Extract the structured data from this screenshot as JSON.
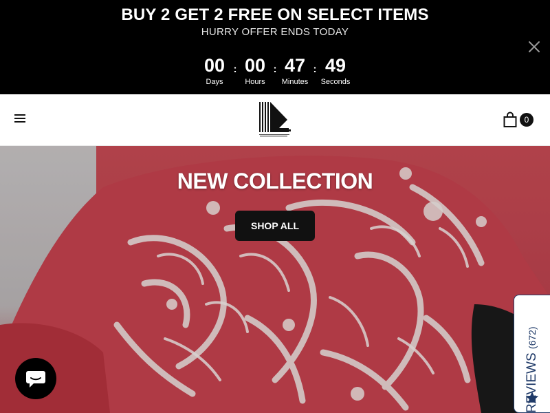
{
  "promo": {
    "title": "BUY 2 GET 2 FREE ON SELECT ITEMS",
    "subtitle": "HURRY OFFER ENDS TODAY",
    "close_icon": "close-icon",
    "countdown": [
      {
        "value": "00",
        "label": "Days"
      },
      {
        "value": "00",
        "label": "Hours"
      },
      {
        "value": "47",
        "label": "Minutes"
      },
      {
        "value": "49",
        "label": "Seconds"
      }
    ],
    "separator": ":"
  },
  "header": {
    "menu_icon": "hamburger-menu-icon",
    "logo_icon": "brand-logo",
    "cart_icon": "shopping-bag-icon",
    "cart_count": "0"
  },
  "hero": {
    "title": "NEW COLLECTION",
    "button_label": "SHOP ALL",
    "accent_color": "#c94b55"
  },
  "reviews_tab": {
    "label": "REVIEWS",
    "count": "(672)",
    "icon": "star-icon",
    "color": "#1f3a68"
  },
  "chat": {
    "icon": "chat-bubble-icon"
  }
}
